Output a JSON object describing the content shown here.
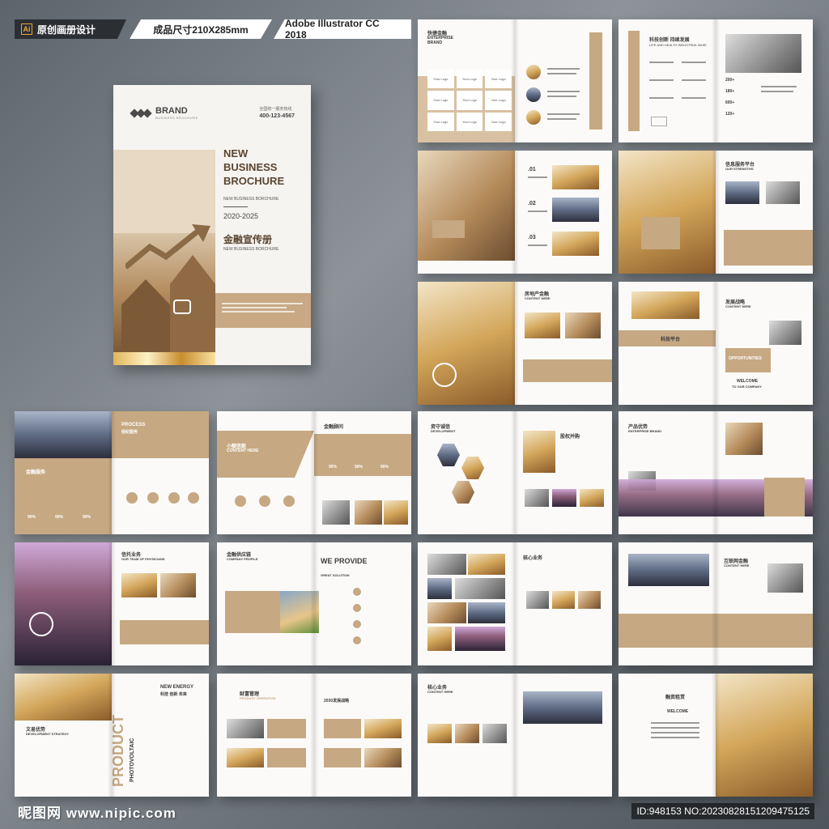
{
  "banner": {
    "ai_icon": "Ai",
    "label1": "原创画册设计",
    "label2": "成品尺寸210X285mm",
    "label3": "Adobe Illustrator CC 2018"
  },
  "cover": {
    "brand": "BRAND",
    "brand_sub": "BUSINESS BROCHURE",
    "hotline_label": "全国统一服务热线",
    "hotline": "400-123-4567",
    "title": [
      "NEW",
      "BUSINESS",
      "BROCHURE"
    ],
    "subtitle": "NEW BUSINESS BORCHURE",
    "years": "2020-2025",
    "cn_title": "金融宣传册",
    "subtitle2": "NEW BUSINESS BORCHURE"
  },
  "spreads": {
    "s1_title": "快捷金融",
    "s1_sub": "ENTERPRISE BRAND",
    "logo_cell": "Your Logo",
    "s2_title": "科技创新 持续发展",
    "s2_sub": "LIFE AND HEALTH INDUSTRIAL BASE",
    "s2_vertical": "BUSINESS BROCHURE DESIGN",
    "s2_stats": [
      "200+",
      "180+",
      "600+",
      "120+"
    ],
    "s3_nums": [
      ".01",
      ".02",
      ".03"
    ],
    "s4_title": "信息服务平台",
    "s4_sub": "OUR STRENGTHS",
    "s5_title": "房地产金融",
    "s5_sub": "CONTENT HERE",
    "s6_title": "发展战略",
    "s6_sub": "CONTENT HERE",
    "s6_platform": "科技平台",
    "s6_opp": "OPPORTUNITIES",
    "s6_welcome": "WELCOME",
    "s6_welcome_sub": "TO OUR COMPANY",
    "s7_title": "PROCESS",
    "s7_sub": "经纪服务",
    "s7_label": "金融服务",
    "s7_pcts": [
      "90%",
      "99%",
      "90%"
    ],
    "s8_title": "小额信款",
    "s8_sub": "CONTENT HERE",
    "s8_head": "金融顾问",
    "s8_pcts": [
      "90%",
      "90%",
      "90%"
    ],
    "s9_title": "资守诚信",
    "s9_sub": "DEVELOPMENT",
    "s9_head": "股权并购",
    "s10_title": "产品优势",
    "s10_sub": "ENTERPRISE BRAND",
    "s11_title": "信托业务",
    "s11_sub": "OUR TEAM OF PHYSICIANS",
    "s12_title": "金融供应链",
    "s12_sub": "COMPANY PROFILE",
    "s12_we": "WE PROVIDE",
    "s12_we_sub": "GREAT SOLUTION",
    "s13_title": "核心业务",
    "s14_title": "互联网金融",
    "s14_sub": "CONTENT HERE",
    "s15_title": "NEW ENERGY",
    "s15_cn": "科技 创新 未来",
    "s15_left": "文易优势",
    "s15_left_sub": "DEVELOPMENT STRATEGY",
    "s15_vertical": "PRODUCT",
    "s15_vertical2": "PHOTOVOLTAIC",
    "s16_title": "财富管理",
    "s16_sub": "PRODUCT OPERATION",
    "s16_year": "2030发展战略",
    "s17_title": "核心业务",
    "s17_sub": "CONTENT HERE",
    "s18_title": "融资租赁",
    "s18_sub": "WELCOME"
  },
  "footer": {
    "watermark": "昵图网 www.nipic.com",
    "id": "ID:948153 NO:20230828151209475125"
  }
}
